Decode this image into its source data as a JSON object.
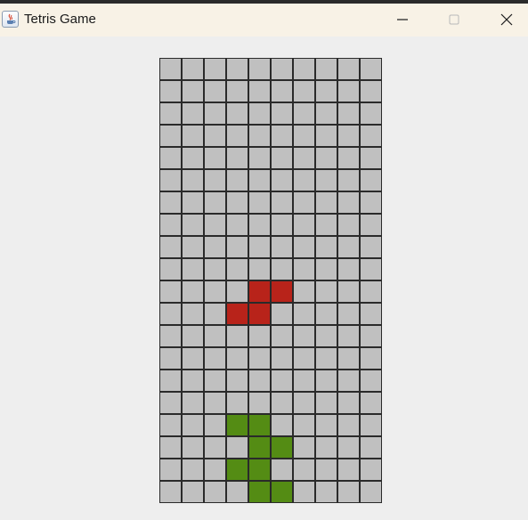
{
  "window": {
    "title": "Tetris Game",
    "app_icon": "java-icon",
    "controls": [
      "minimize-icon",
      "maximize-icon",
      "close-icon"
    ]
  },
  "board": {
    "columns": 10,
    "rows": 20,
    "empty_color": "#c0c0c0",
    "grid_line_color": "#2a2a2a",
    "falling_piece": {
      "shape": "S",
      "color": "#b8231a",
      "cells": [
        [
          4,
          10
        ],
        [
          5,
          10
        ],
        [
          3,
          11
        ],
        [
          4,
          11
        ]
      ]
    },
    "settled_blocks": {
      "color": "#548c14",
      "cells": [
        [
          3,
          16
        ],
        [
          4,
          16
        ],
        [
          4,
          17
        ],
        [
          5,
          17
        ],
        [
          3,
          18
        ],
        [
          4,
          18
        ],
        [
          4,
          19
        ],
        [
          5,
          19
        ]
      ]
    }
  }
}
